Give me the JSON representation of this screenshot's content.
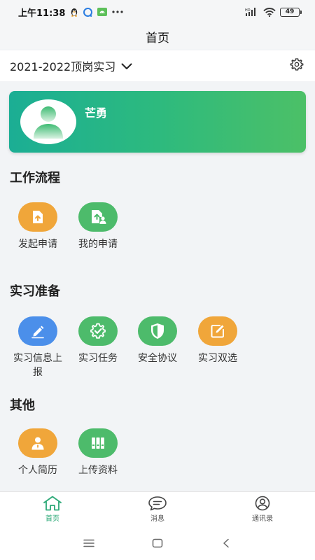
{
  "status": {
    "time": "上午11:38",
    "battery": "49"
  },
  "nav": {
    "title": "首页"
  },
  "term": {
    "label": "2021-2022顶岗实习"
  },
  "profile": {
    "name": "芒勇"
  },
  "sections": {
    "workflow": {
      "title": "工作流程",
      "items": [
        {
          "label": "发起申请",
          "icon": "upload-file-icon",
          "color": "#f0a63a"
        },
        {
          "label": "我的申请",
          "icon": "my-application-icon",
          "color": "#4dbb6b"
        }
      ]
    },
    "prep": {
      "title": "实习准备",
      "items": [
        {
          "label": "实习信息上报",
          "icon": "edit-pencil-icon",
          "color": "#4b8fea"
        },
        {
          "label": "实习任务",
          "icon": "task-gear-icon",
          "color": "#4dbb6b"
        },
        {
          "label": "安全协议",
          "icon": "shield-icon",
          "color": "#4dbb6b"
        },
        {
          "label": "实习双选",
          "icon": "edit-box-icon",
          "color": "#f0a63a"
        }
      ]
    },
    "other": {
      "title": "其他",
      "items": [
        {
          "label": "个人简历",
          "icon": "resume-person-icon",
          "color": "#f0a63a"
        },
        {
          "label": "上传资料",
          "icon": "binders-icon",
          "color": "#4dbb6b"
        }
      ]
    }
  },
  "tabs": [
    {
      "label": "首页",
      "icon": "home-icon",
      "active": true
    },
    {
      "label": "消息",
      "icon": "message-icon",
      "active": false
    },
    {
      "label": "通讯录",
      "icon": "contacts-icon",
      "active": false
    }
  ],
  "colors": {
    "accent": "#2aa876",
    "orange": "#f0a63a",
    "green": "#4dbb6b",
    "blue": "#4b8fea"
  }
}
